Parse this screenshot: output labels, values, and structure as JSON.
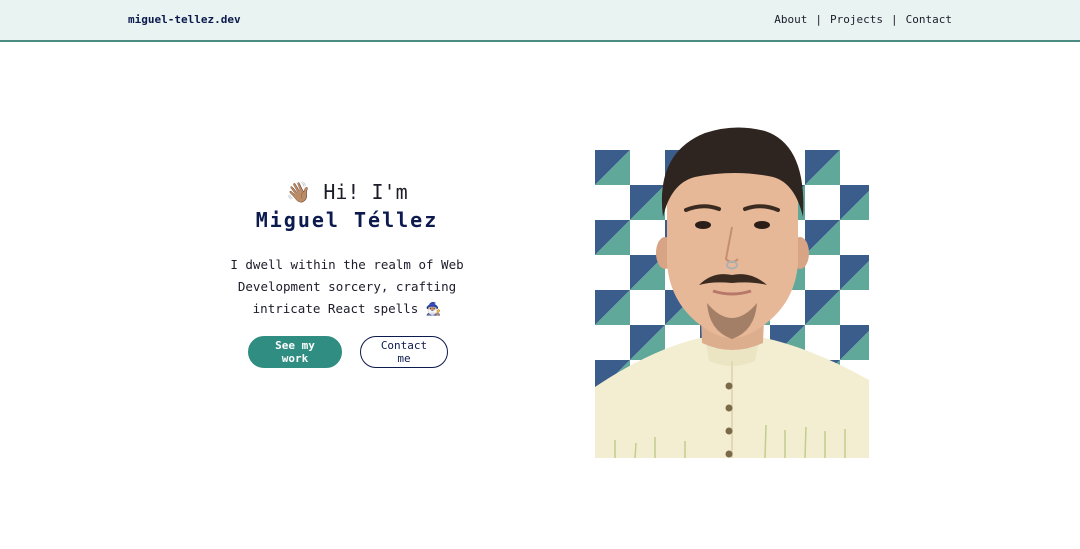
{
  "nav": {
    "brand": "miguel-tellez.dev",
    "links": [
      "About",
      "Projects",
      "Contact"
    ],
    "separator": "|"
  },
  "hero": {
    "wave_emoji": "👋🏽",
    "greeting": "Hi! I'm",
    "name": "Miguel Téllez",
    "description_lines": [
      "I dwell within the realm of Web",
      "Development sorcery, crafting",
      "intricate React spells"
    ],
    "wizard_emoji": "🧙🏽‍♂️",
    "primary_button": "See my work",
    "secondary_button": "Contact me"
  },
  "colors": {
    "nav_bg": "#e9f3f1",
    "navy": "#0c1a4d",
    "teal": "#2f8d82",
    "pattern_teal": "#5fa89a",
    "pattern_blue": "#3b5d8c"
  }
}
